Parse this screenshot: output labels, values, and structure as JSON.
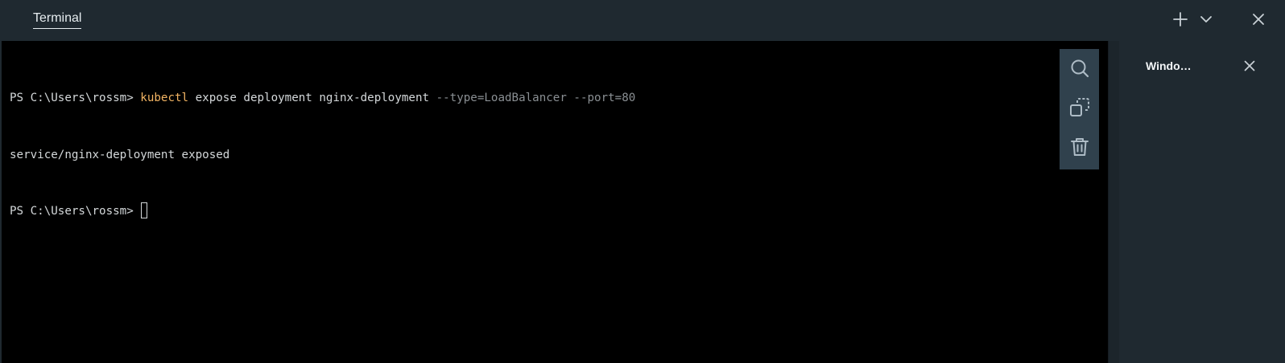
{
  "header": {
    "tab_label": "Terminal",
    "icons": {
      "add": "plus-icon",
      "dropdown": "chevron-down-icon",
      "close": "close-icon"
    }
  },
  "terminal": {
    "lines": [
      {
        "prompt": "PS C:\\Users\\rossm> ",
        "command": "kubectl",
        "args": " expose deployment nginx-deployment ",
        "params": "--type=LoadBalancer --port=80"
      },
      {
        "output": "service/nginx-deployment exposed"
      },
      {
        "prompt": "PS C:\\Users\\rossm> "
      }
    ]
  },
  "toolbar": {
    "icons": [
      "search-icon",
      "copy-icon",
      "trash-icon"
    ]
  },
  "side_panel": {
    "title": "Windo…",
    "close_icon": "close-icon"
  },
  "colors": {
    "chrome": "#1f2930",
    "terminal_bg": "#000000",
    "text": "#d4d8da",
    "command": "#f2b463",
    "parameter": "#8a8f93",
    "toolbar_bg": "#30414d"
  }
}
